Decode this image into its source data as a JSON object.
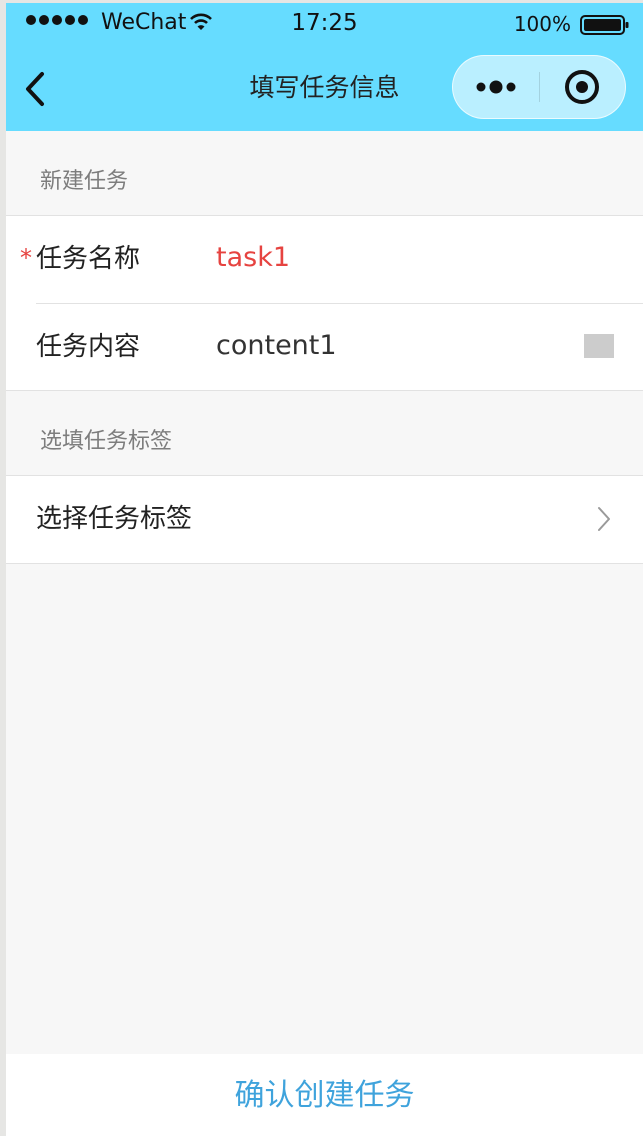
{
  "status_bar": {
    "carrier": "WeChat",
    "time": "17:25",
    "battery": "100%"
  },
  "navbar": {
    "title": "填写任务信息",
    "back_icon": "chevron-left-icon",
    "more_icon": "more-dots-icon",
    "close_icon": "target-close-icon"
  },
  "sections": {
    "new_task": {
      "header": "新建任务",
      "task_name": {
        "required_mark": "*",
        "label": "任务名称",
        "value": "task1"
      },
      "task_content": {
        "label": "任务内容",
        "value": "content1"
      }
    },
    "tags": {
      "header": "选填任务标签",
      "select_tags": {
        "label": "选择任务标签",
        "icon": "chevron-right-icon"
      }
    }
  },
  "footer": {
    "confirm_label": "确认创建任务"
  },
  "colors": {
    "navbar_bg": "#66dcff",
    "page_bg": "#f7f7f7",
    "error_text": "#e64340",
    "link_text": "#3fa3dc"
  }
}
